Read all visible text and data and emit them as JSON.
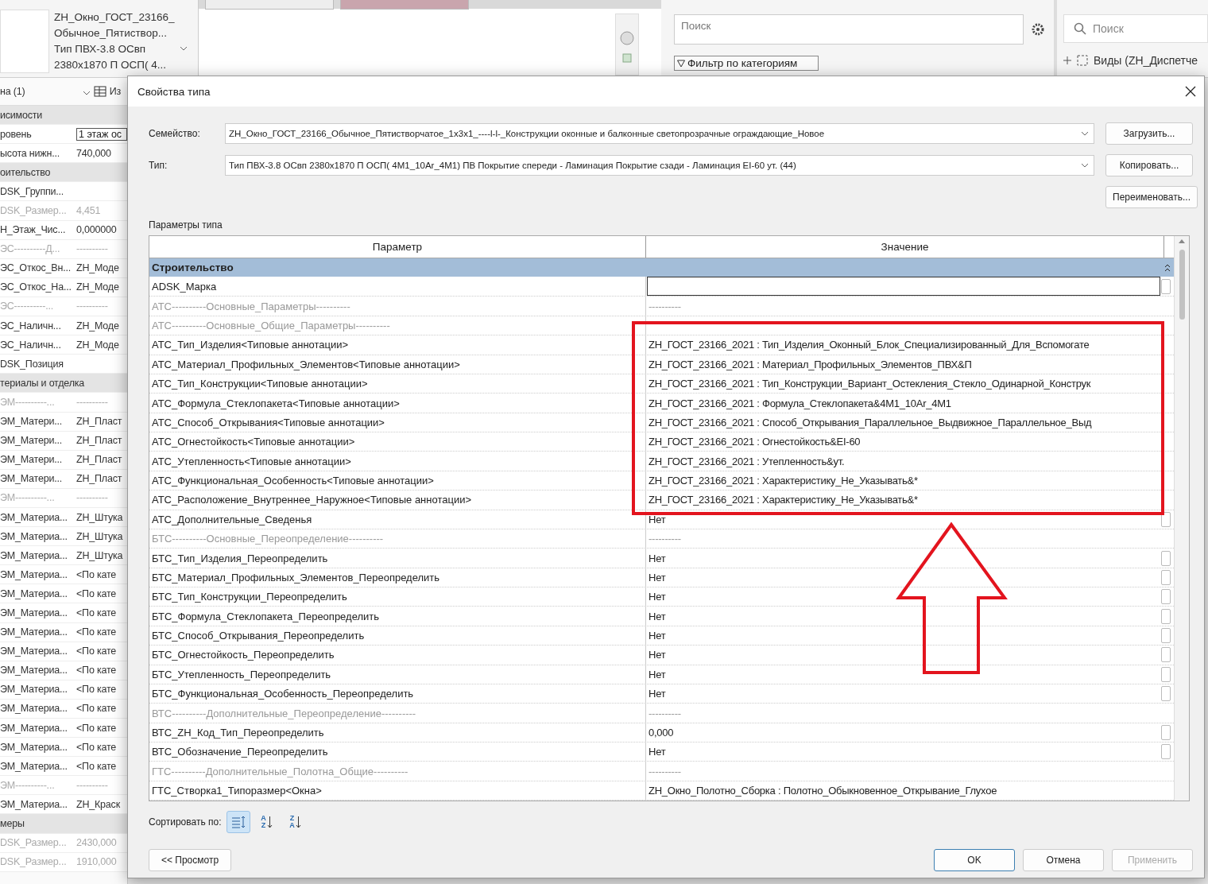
{
  "properties_panel": {
    "type_lines": [
      "ZH_Окно_ГОСТ_23166_",
      "Обычное_Пятиствор...",
      "Тип ПВХ-3.8 ОСвп",
      "2380x1870 П ОСП( 4..."
    ],
    "instance_filter": "на (1)",
    "edit_type": "Из",
    "rows": [
      {
        "kind": "group",
        "name": "исимости"
      },
      {
        "kind": "field",
        "name": "ровень",
        "value": "1 этаж ос"
      },
      {
        "kind": "value",
        "name": "ысота нижн...",
        "value": "740,000"
      },
      {
        "kind": "group",
        "name": "оительство"
      },
      {
        "kind": "value",
        "name": "DSK_Группи..."
      },
      {
        "kind": "dim",
        "name": "DSK_Размер...",
        "value": "4,451"
      },
      {
        "kind": "value",
        "name": "Н_Этаж_Чис...",
        "value": "0,000000"
      },
      {
        "kind": "dim",
        "name": "ЭС----------Д...",
        "value": "----------"
      },
      {
        "kind": "value",
        "name": "ЭС_Откос_Вн...",
        "value": "ZH_Моде"
      },
      {
        "kind": "value",
        "name": "ЭС_Откос_На...",
        "value": "ZH_Моде"
      },
      {
        "kind": "dim",
        "name": "ЭС----------...",
        "value": "----------"
      },
      {
        "kind": "value",
        "name": "ЭС_Наличн...",
        "value": "ZH_Моде"
      },
      {
        "kind": "value",
        "name": "ЭС_Наличн...",
        "value": "ZH_Моде"
      },
      {
        "kind": "value",
        "name": "DSK_Позиция"
      },
      {
        "kind": "group",
        "name": "териалы и отделка"
      },
      {
        "kind": "dim",
        "name": "ЭМ----------...",
        "value": "----------"
      },
      {
        "kind": "value",
        "name": "ЭМ_Матери...",
        "value": "ZH_Пласт"
      },
      {
        "kind": "value",
        "name": "ЭМ_Матери...",
        "value": "ZH_Пласт"
      },
      {
        "kind": "value",
        "name": "ЭМ_Матери...",
        "value": "ZH_Пласт"
      },
      {
        "kind": "value",
        "name": "ЭМ_Матери...",
        "value": "ZH_Пласт"
      },
      {
        "kind": "dim",
        "name": "ЭМ----------...",
        "value": "----------"
      },
      {
        "kind": "value",
        "name": "ЭМ_Материа...",
        "value": "ZH_Штука"
      },
      {
        "kind": "value",
        "name": "ЭМ_Материа...",
        "value": "ZH_Штука"
      },
      {
        "kind": "value",
        "name": "ЭМ_Материа...",
        "value": "ZH_Штука"
      },
      {
        "kind": "value",
        "name": "ЭМ_Материа...",
        "value": "<По кате"
      },
      {
        "kind": "value",
        "name": "ЭМ_Материа...",
        "value": "<По кате"
      },
      {
        "kind": "value",
        "name": "ЭМ_Материа...",
        "value": "<По кате"
      },
      {
        "kind": "value",
        "name": "ЭМ_Материа...",
        "value": "<По кате"
      },
      {
        "kind": "value",
        "name": "ЭМ_Материа...",
        "value": "<По кате"
      },
      {
        "kind": "value",
        "name": "ЭМ_Материа...",
        "value": "<По кате"
      },
      {
        "kind": "value",
        "name": "ЭМ_Материа...",
        "value": "<По кате"
      },
      {
        "kind": "value",
        "name": "ЭМ_Материа...",
        "value": "<По кате"
      },
      {
        "kind": "value",
        "name": "ЭМ_Материа...",
        "value": "<По кате"
      },
      {
        "kind": "value",
        "name": "ЭМ_Материа...",
        "value": "<По кате"
      },
      {
        "kind": "value",
        "name": "ЭМ_Материа...",
        "value": "<По кате"
      },
      {
        "kind": "dim",
        "name": "ЭМ----------...",
        "value": "----------"
      },
      {
        "kind": "value",
        "name": "ЭМ_Материа...",
        "value": "ZH_Краск"
      },
      {
        "kind": "group",
        "name": "меры"
      },
      {
        "kind": "dim",
        "name": "DSK_Размер...",
        "value": "2430,000"
      },
      {
        "kind": "dim",
        "name": "DSK_Размер...",
        "value": "1910,000"
      }
    ]
  },
  "family_browser": {
    "search": {
      "placeholder": "Поиск"
    },
    "filter": "Фильтр по категориям"
  },
  "project_browser": {
    "search": {
      "placeholder": "Поиск"
    },
    "tree_item": "Виды (ZH_Диспетче"
  },
  "dialog": {
    "title": "Свойства типа",
    "family_label": "Семейство:",
    "family": "ZH_Окно_ГОСТ_23166_Обычное_Пятистворчатое_1x3x1_----l-l-_Конструкции оконные и балконные светопрозрачные ограждающие_Новое",
    "type_label": "Тип:",
    "type": "Тип ПВХ-3.8 ОСвп 2380x1870 П ОСП( 4М1_10Ar_4М1) ПВ Покрытие спереди - Ламинация Покрытие сзади - Ламинация EI-60 ут. (44)",
    "side_buttons": [
      "Загрузить...",
      "Копировать...",
      "Переименовать..."
    ],
    "params_label": "Параметры типа",
    "table": {
      "columns": [
        "Параметр",
        "Значение"
      ],
      "group": "Строительство",
      "rows": [
        {
          "kind": "edit",
          "name": "ADSK_Марка",
          "value": ""
        },
        {
          "kind": "dim",
          "name": "АТС----------Основные_Параметры----------",
          "value": "----------"
        },
        {
          "kind": "dim",
          "name": "АТС----------Основные_Общие_Параметры----------"
        },
        {
          "kind": "text",
          "name": "АТС_Тип_Изделия<Типовые аннотации>",
          "value": "ZH_ГОСТ_23166_2021 : Тип_Изделия_Оконный_Блок_Специализированный_Для_Вспомогате"
        },
        {
          "kind": "text",
          "name": "АТС_Материал_Профильных_Элементов<Типовые аннотации>",
          "value": "ZH_ГОСТ_23166_2021 : Материал_Профильных_Элементов_ПВХ&П"
        },
        {
          "kind": "text",
          "name": "АТС_Тип_Конструкции<Типовые аннотации>",
          "value": "ZH_ГОСТ_23166_2021 : Тип_Конструкции_Вариант_Остекления_Стекло_Одинарной_Конструк"
        },
        {
          "kind": "text",
          "name": "АТС_Формула_Стеклопакета<Типовые аннотации>",
          "value": "ZH_ГОСТ_23166_2021 : Формула_Стеклопакета&4М1_10Ar_4М1"
        },
        {
          "kind": "text",
          "name": "АТС_Способ_Открывания<Типовые аннотации>",
          "value": "ZH_ГОСТ_23166_2021 : Способ_Открывания_Параллельное_Выдвижное_Параллельное_Выд"
        },
        {
          "kind": "text",
          "name": "АТС_Огнестойкость<Типовые аннотации>",
          "value": "ZH_ГОСТ_23166_2021 : Огнестойкость&EI-60"
        },
        {
          "kind": "text",
          "name": "АТС_Утепленность<Типовые аннотации>",
          "value": "ZH_ГОСТ_23166_2021 : Утепленность&ут."
        },
        {
          "kind": "text",
          "name": "АТС_Функциональная_Особенность<Типовые аннотации>",
          "value": "ZH_ГОСТ_23166_2021 : Характеристику_Не_Указывать&*"
        },
        {
          "kind": "text",
          "name": "АТС_Расположение_Внутреннее_Наружное<Типовые аннотации>",
          "value": "ZH_ГОСТ_23166_2021 : Характеристику_Не_Указывать&*"
        },
        {
          "kind": "param",
          "name": "АТС_Дополнительные_Сведенья",
          "value": "Нет"
        },
        {
          "kind": "dim",
          "name": "БТС----------Основные_Переопределение----------",
          "value": "----------"
        },
        {
          "kind": "param",
          "name": "БТС_Тип_Изделия_Переопределить",
          "value": "Нет"
        },
        {
          "kind": "param",
          "name": "БТС_Материал_Профильных_Элементов_Переопределить",
          "value": "Нет"
        },
        {
          "kind": "param",
          "name": "БТС_Тип_Конструкции_Переопределить",
          "value": "Нет"
        },
        {
          "kind": "param",
          "name": "БТС_Формула_Стеклопакета_Переопределить",
          "value": "Нет"
        },
        {
          "kind": "param",
          "name": "БТС_Способ_Открывания_Переопределить",
          "value": "Нет"
        },
        {
          "kind": "param",
          "name": "БТС_Огнестойкость_Переопределить",
          "value": "Нет"
        },
        {
          "kind": "param",
          "name": "БТС_Утепленность_Переопределить",
          "value": "Нет"
        },
        {
          "kind": "param",
          "name": "БТС_Функциональная_Особенность_Переопределить",
          "value": "Нет"
        },
        {
          "kind": "dim",
          "name": "ВТС----------Дополнительные_Переопределение----------",
          "value": "----------"
        },
        {
          "kind": "param",
          "name": "ВТС_ZH_Код_Тип_Переопределить",
          "value": "0,000"
        },
        {
          "kind": "param",
          "name": "ВТС_Обозначение_Переопределить",
          "value": "Нет"
        },
        {
          "kind": "dim",
          "name": "ГТС----------Дополнительные_Полотна_Общие----------",
          "value": "----------"
        },
        {
          "kind": "text",
          "name": "ГТС_Створка1_Типоразмер<Окна>",
          "value": "ZH_Окно_Полотно_Сборка : Полотно_Обыкновенное_Открывание_Глухое"
        }
      ]
    },
    "sort_label": "Сортировать по:",
    "sort_buttons": [
      {
        "kind": "category",
        "selected": true
      },
      {
        "kind": "letters",
        "top": "A",
        "bottom": "Z",
        "selected": false
      },
      {
        "kind": "letters",
        "top": "Z",
        "bottom": "A",
        "selected": false
      }
    ],
    "preview_button": "<< Просмотр",
    "buttons": [
      {
        "label": "OK",
        "kind": "default",
        "disabled": false
      },
      {
        "label": "Отмена",
        "kind": "normal",
        "disabled": false
      },
      {
        "label": "Применить",
        "kind": "normal",
        "disabled": true
      }
    ]
  }
}
